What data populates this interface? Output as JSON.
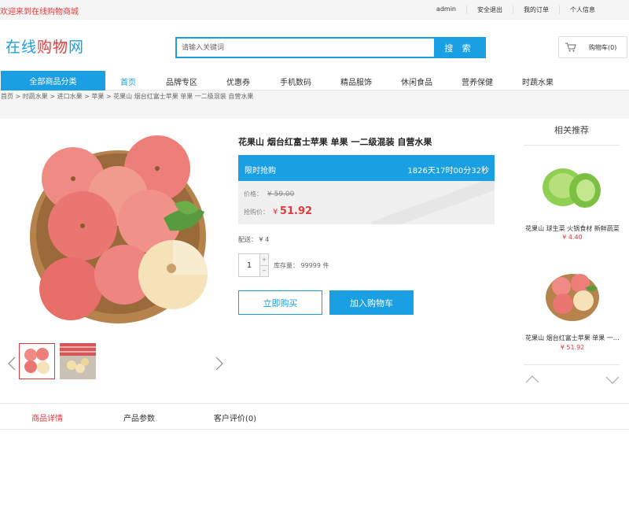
{
  "topbar": {
    "welcome": "欢迎来到在线购物商城",
    "links": [
      "admin",
      "安全退出",
      "我的订单",
      "个人信息"
    ]
  },
  "header": {
    "logo_part1": "在线",
    "logo_part2": "购物",
    "logo_part3": "网",
    "search_placeholder": "请输入关键词",
    "search_button": "搜 索",
    "cart_label": "购物车(0)"
  },
  "nav": {
    "all_categories": "全部商品分类",
    "items": [
      "首页",
      "品牌专区",
      "优惠券",
      "手机数码",
      "精品服饰",
      "休闲食品",
      "营养保健",
      "时蔬水果"
    ],
    "active_index": 0
  },
  "breadcrumb": "首页 > 时蔬水果 > 进口水果 > 苹果 > 花果山 烟台红富士苹果 单果 一二级混装 自营水果",
  "product": {
    "title": "花果山 烟台红富士苹果 单果 一二级混装 自营水果",
    "flash_label": "限时抢购",
    "countdown": "1826天17时00分32秒",
    "price_label": "价格：",
    "old_price": "¥ 59.00",
    "flash_price_label": "抢购价：",
    "currency": "¥",
    "flash_price": "51.92",
    "shipping": "配送： ¥ 4",
    "quantity": "1",
    "qty_plus": "+",
    "qty_minus": "−",
    "stock": "库存量： 99999 件",
    "buy_now": "立即购买",
    "add_to_cart": "加入购物车"
  },
  "recommend": {
    "title": "相关推荐",
    "items": [
      {
        "name": "花果山 球生菜 火锅食材 新鲜蔬菜",
        "price": "¥ 4.40"
      },
      {
        "name": "花果山 烟台红富士苹果 单果 一…",
        "price": "¥ 51.92"
      }
    ]
  },
  "tabs": [
    "商品详情",
    "产品参数",
    "客户评价(0)"
  ],
  "colors": {
    "accent": "#1b9fe3",
    "price_red": "#e4393c"
  }
}
